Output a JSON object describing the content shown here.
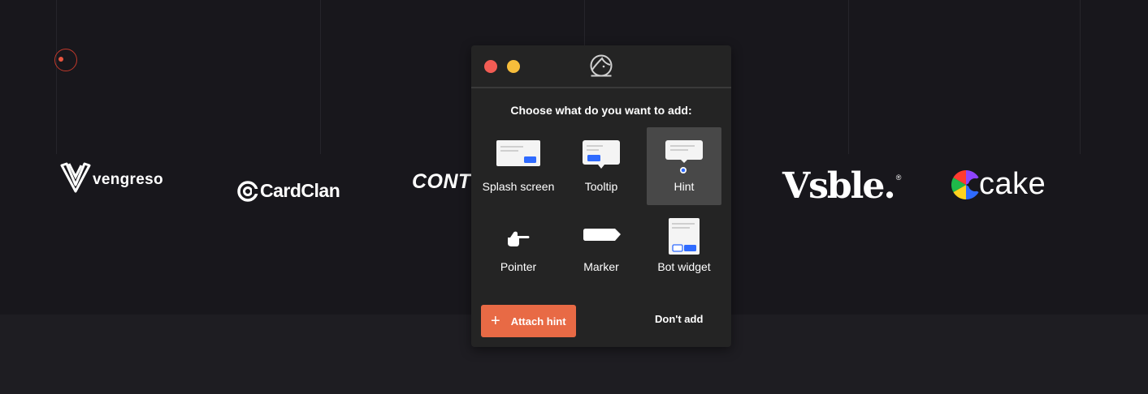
{
  "background": {
    "logos": {
      "vengreso": "vengreso",
      "cardclan": "CardClan",
      "conti": "CONTI",
      "vsble": "Vsble.",
      "vsble_mark": "®",
      "cake": "cake"
    }
  },
  "dialog": {
    "heading": "Choose what do you want to add:",
    "options": [
      {
        "label": "Splash screen",
        "icon": "splash-screen-icon"
      },
      {
        "label": "Tooltip",
        "icon": "tooltip-icon"
      },
      {
        "label": "Hint",
        "icon": "hint-icon",
        "selected": true
      },
      {
        "label": "Pointer",
        "icon": "pointer-hand-icon"
      },
      {
        "label": "Marker",
        "icon": "marker-icon"
      },
      {
        "label": "Bot widget",
        "icon": "bot-widget-icon"
      }
    ],
    "attach_label": "Attach hint",
    "dont_add_label": "Don't add"
  },
  "colors": {
    "accent": "#e86a45",
    "close": "#f25c54",
    "minimize": "#f7bd3b",
    "selection": "#484848",
    "blue": "#2f6bff"
  }
}
